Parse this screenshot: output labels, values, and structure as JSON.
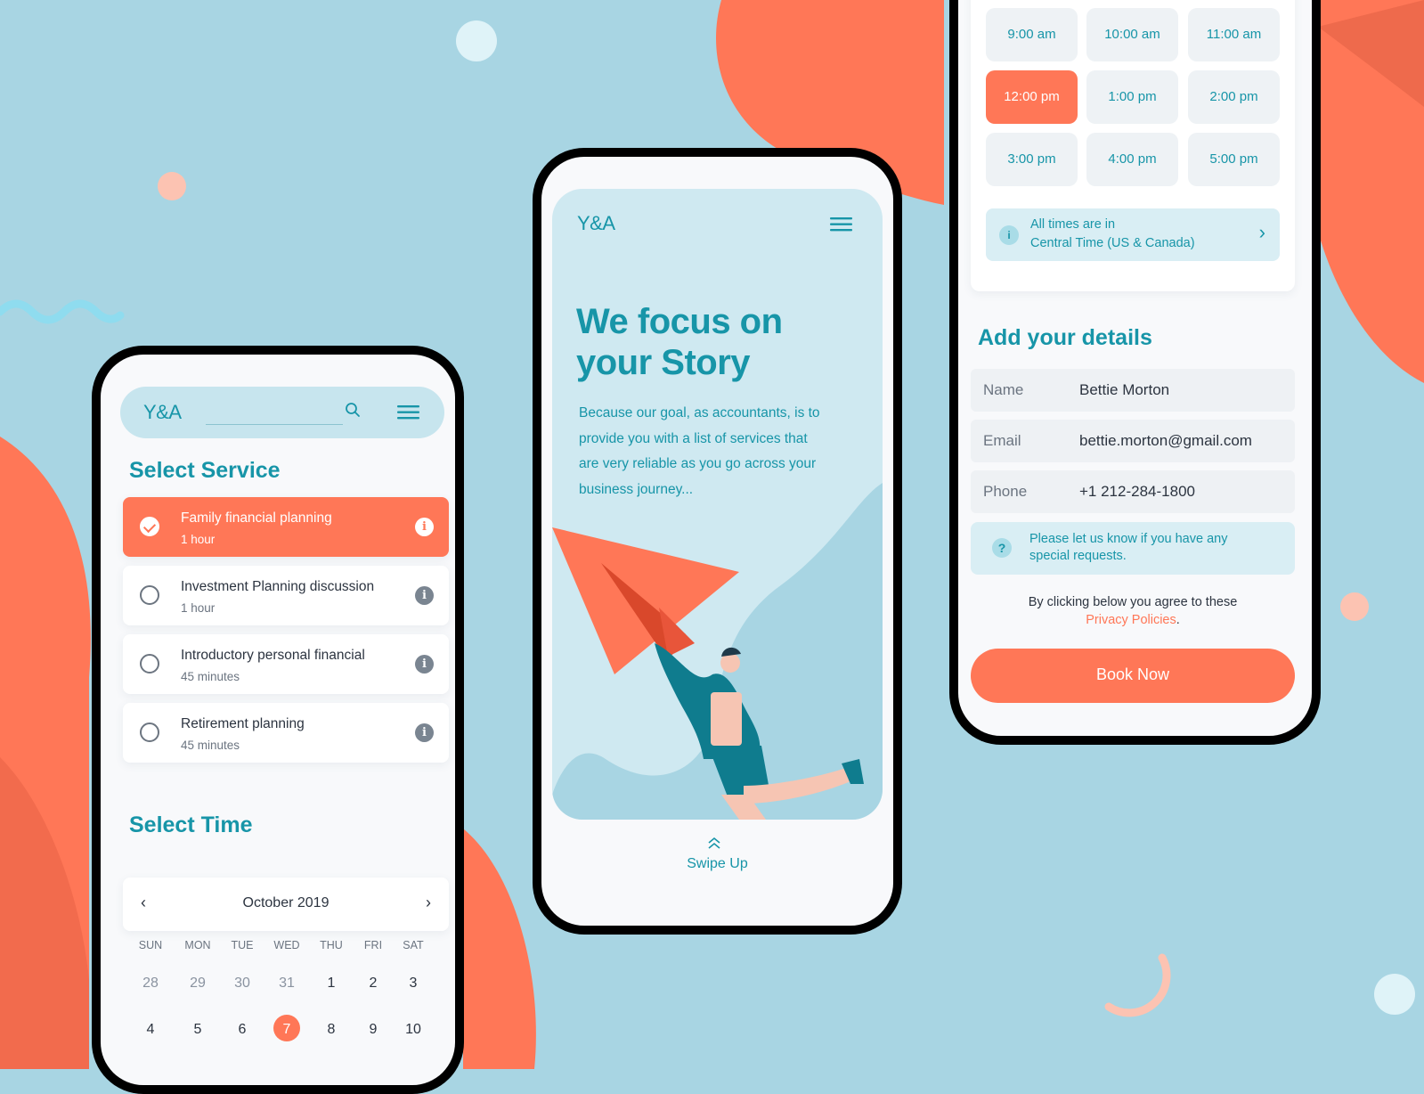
{
  "colors": {
    "background": "#a8d5e3",
    "accent": "#ff7757",
    "teal": "#1795a8"
  },
  "left_phone": {
    "logo": "Y&A",
    "search_placeholder": "",
    "select_service_title": "Select Service",
    "services": [
      {
        "title": "Family financial planning",
        "duration": "1 hour",
        "selected": true
      },
      {
        "title": "Investment Planning discussion",
        "duration": "1 hour",
        "selected": false
      },
      {
        "title": "Introductory personal financial",
        "duration": "45 minutes",
        "selected": false
      },
      {
        "title": "Retirement planning",
        "duration": "45 minutes",
        "selected": false
      }
    ],
    "select_time_title": "Select Time",
    "calendar": {
      "month": "October 2019",
      "weekdays": [
        "SUN",
        "MON",
        "TUE",
        "WED",
        "THU",
        "FRI",
        "SAT"
      ],
      "week1": [
        "28",
        "29",
        "30",
        "31",
        "1",
        "2",
        "3"
      ],
      "week2": [
        "4",
        "5",
        "6",
        "7",
        "8",
        "9",
        "10"
      ],
      "selected_day": "7"
    }
  },
  "middle_phone": {
    "logo": "Y&A",
    "headline_line1": "We focus on",
    "headline_line2": "your Story",
    "body_lines": [
      "Because our goal, as accountants, is to",
      "provide you with a list of services that",
      "are very reliable as you go across your",
      "business journey..."
    ],
    "swipe_label": "Swipe Up"
  },
  "right_phone": {
    "time_slots": [
      "9:00 am",
      "10:00 am",
      "11:00 am",
      "12:00 pm",
      "1:00 pm",
      "2:00 pm",
      "3:00 pm",
      "4:00 pm",
      "5:00 pm"
    ],
    "selected_slot": "12:00 pm",
    "timezone_line1": "All times are in",
    "timezone_line2": "Central Time (US & Canada)",
    "details_title": "Add your details",
    "fields": [
      {
        "label": "Name",
        "value": "Bettie Morton"
      },
      {
        "label": "Email",
        "value": "bettie.morton@gmail.com"
      },
      {
        "label": "Phone",
        "value": "+1 212-284-1800"
      }
    ],
    "request_line1": "Please let us know if you have any",
    "request_line2": "special requests.",
    "agree_text": "By clicking below you agree to these",
    "privacy_link": "Privacy Policies",
    "privacy_period": ".",
    "book_button": "Book Now"
  }
}
